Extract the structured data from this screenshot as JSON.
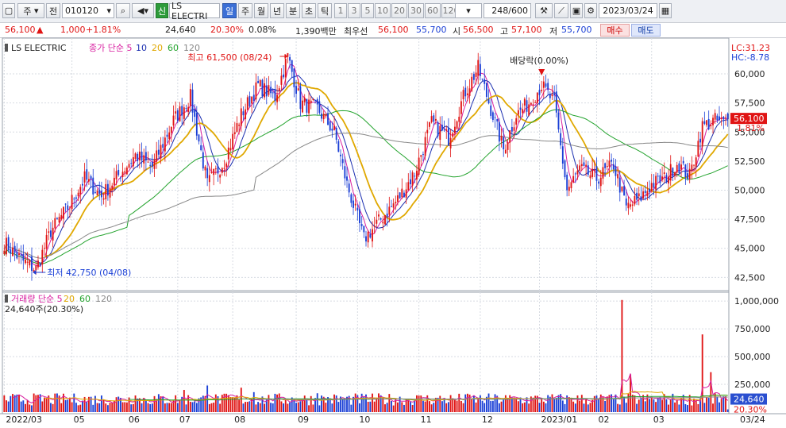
{
  "toolbar": {
    "market_label": "주",
    "market_label2": "전",
    "code": "010120",
    "signal_label": "신",
    "stock_name": "LS ELECTRI",
    "periods": [
      "일",
      "주",
      "월",
      "년",
      "분",
      "초",
      "틱"
    ],
    "counts": [
      "1",
      "3",
      "5",
      "10",
      "20",
      "30",
      "60",
      "120"
    ],
    "bar_count": "248/600",
    "date": "2023/03/24"
  },
  "info": {
    "price": "56,100",
    "change": "1,000",
    "change_pct": "+1.81%",
    "volume": "24,640",
    "volume_ratio": "20.30%",
    "turnover": "0.08%",
    "amount": "1,390백만",
    "best_label": "최우선",
    "ask": "56,100",
    "bid": "55,700",
    "open_label": "시",
    "open": "56,500",
    "high_label": "고",
    "high": "57,100",
    "low_label": "저",
    "low": "55,700",
    "buy_label": "매수",
    "sell_label": "매도"
  },
  "colors": {
    "up": "#e01414",
    "down": "#1a3fd6",
    "ma5": "#d81fa0",
    "ma10": "#1b2fb0",
    "ma20": "#e0a800",
    "ma60": "#23a32d",
    "ma120": "#888888"
  },
  "chart_data": [
    {
      "type": "candlestick",
      "legend": [
        "LS ELECTRIC",
        "종가 단순 5",
        "10",
        "20",
        "60",
        "120"
      ],
      "right_labels": [
        "LC:31.23",
        "HC:-8.78"
      ],
      "last_price_label": "56,100",
      "last_pct_label": "1.81%",
      "y_ticks": [
        42500,
        45000,
        47500,
        50000,
        52500,
        55000,
        57500,
        60000
      ],
      "ylim": [
        41500,
        62800
      ],
      "x_tick_labels": [
        "2022/03",
        "05",
        "06",
        "07",
        "08",
        "09",
        "10",
        "11",
        "12",
        "2023/01",
        "02",
        "03",
        "03/24"
      ],
      "x_tick_index": [
        0,
        32,
        58,
        82,
        108,
        138,
        167,
        196,
        225,
        253,
        280,
        306,
        342
      ],
      "annotations": {
        "high": "최고 61,500 (08/24)",
        "low": "최저 42,750 (04/08)",
        "dividend": "배당락(0.00%)"
      },
      "anchors": [
        [
          0,
          45500
        ],
        [
          8,
          44000
        ],
        [
          15,
          43200
        ],
        [
          22,
          46500
        ],
        [
          30,
          48500
        ],
        [
          38,
          51000
        ],
        [
          46,
          49500
        ],
        [
          55,
          51500
        ],
        [
          62,
          53000
        ],
        [
          70,
          52000
        ],
        [
          80,
          56000
        ],
        [
          88,
          58000
        ],
        [
          96,
          50500
        ],
        [
          104,
          52500
        ],
        [
          112,
          56500
        ],
        [
          120,
          59000
        ],
        [
          128,
          58000
        ],
        [
          134,
          61500
        ],
        [
          140,
          57500
        ],
        [
          148,
          57000
        ],
        [
          156,
          55000
        ],
        [
          162,
          50500
        ],
        [
          170,
          45800
        ],
        [
          178,
          47500
        ],
        [
          186,
          49200
        ],
        [
          194,
          51500
        ],
        [
          202,
          55800
        ],
        [
          210,
          54500
        ],
        [
          218,
          58500
        ],
        [
          224,
          60500
        ],
        [
          230,
          57000
        ],
        [
          236,
          53500
        ],
        [
          242,
          56500
        ],
        [
          248,
          57500
        ],
        [
          254,
          59000
        ],
        [
          260,
          57500
        ],
        [
          266,
          50000
        ],
        [
          272,
          51800
        ],
        [
          280,
          51000
        ],
        [
          288,
          52200
        ],
        [
          294,
          48500
        ],
        [
          300,
          49200
        ],
        [
          306,
          50500
        ],
        [
          312,
          51000
        ],
        [
          318,
          52300
        ],
        [
          324,
          51200
        ],
        [
          330,
          55500
        ],
        [
          336,
          56000
        ],
        [
          340,
          55800
        ],
        [
          342,
          56100
        ]
      ],
      "volume_axis_ticks": [
        0,
        250000,
        500000,
        750000,
        1000000
      ],
      "volume_legend": [
        "거래량 단순 5",
        "20",
        "60",
        "120"
      ],
      "volume_current": "24,640주(20.30%)",
      "volume_last_label": "24,640",
      "volume_pct_label": "20.30%",
      "volume_spikes": [
        [
          62,
          150000
        ],
        [
          85,
          200000
        ],
        [
          96,
          240000
        ],
        [
          112,
          220000
        ],
        [
          118,
          180000
        ],
        [
          148,
          170000
        ],
        [
          218,
          160000
        ],
        [
          268,
          120000
        ],
        [
          292,
          1010000
        ],
        [
          296,
          340000
        ],
        [
          330,
          700000
        ],
        [
          334,
          360000
        ]
      ]
    }
  ]
}
